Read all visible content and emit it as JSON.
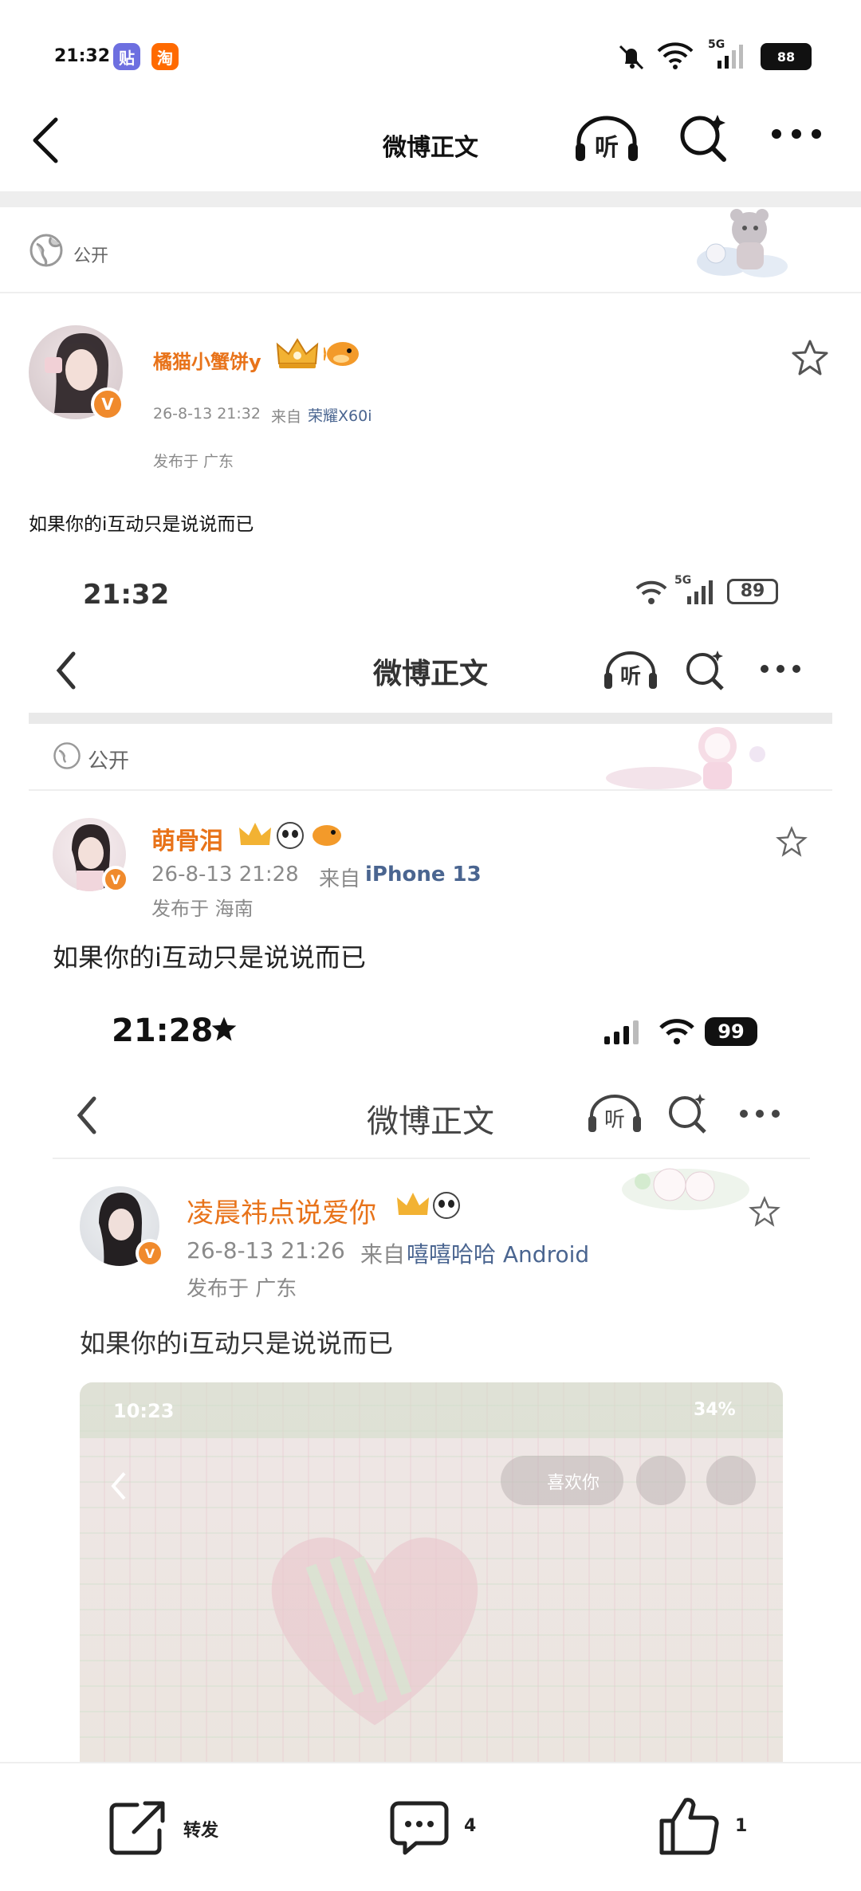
{
  "status_bar": {
    "time": "21:32",
    "app_badge_1": "贴",
    "app_badge_2": "淘",
    "network": "5G",
    "battery": "88"
  },
  "nav": {
    "title": "微博正文",
    "listen_label": "听"
  },
  "visibility": {
    "label": "公开"
  },
  "post": {
    "username": "橘猫小蟹饼y",
    "time": "26-8-13 21:32",
    "source_prefix": "来自",
    "source": "荣耀X60i",
    "location": "发布于 广东",
    "text": "如果你的i互动只是说说而已"
  },
  "shot1": {
    "time": "21:32",
    "network": "5G",
    "battery": "89",
    "nav_title": "微博正文",
    "listen_label": "听",
    "visibility": "公开",
    "username": "萌骨泪",
    "time_post": "26-8-13 21:28",
    "source_prefix": "来自",
    "source": "iPhone 13",
    "location": "发布于 海南",
    "text": "如果你的i互动只是说说而已"
  },
  "shot2": {
    "time": "21:28",
    "battery": "99",
    "nav_title": "微博正文",
    "listen_label": "听",
    "username": "凌晨祎点说爱你",
    "time_post": "26-8-13 21:26",
    "source_prefix": "来自",
    "source": "嘻嘻哈哈 Android",
    "location": "发布于 广东",
    "text": "如果你的i互动只是说说而已"
  },
  "shot3": {
    "time": "10:23",
    "battery": "34%",
    "like_label": "喜欢你"
  },
  "bottom_bar": {
    "repost_label": "转发",
    "comment_count": "4",
    "like_count": "1"
  },
  "colors": {
    "username": "#e8731a",
    "source_link": "#4a6590",
    "verified": "#f08a2c"
  }
}
